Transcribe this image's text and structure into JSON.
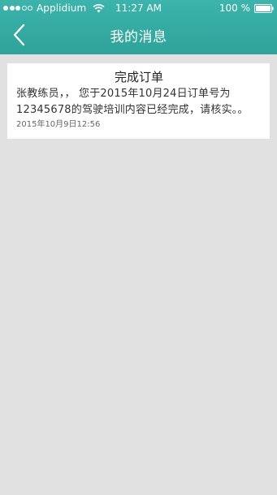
{
  "status_bar": {
    "carrier": "Applidium",
    "time": "11:27 AM",
    "battery": "100 %"
  },
  "nav": {
    "title": "我的消息",
    "back_icon": "chevron-left-icon"
  },
  "colors": {
    "header": "#35aca3",
    "background": "#e2e1e2",
    "card": "#ffffff"
  },
  "messages": [
    {
      "title": "完成订单",
      "body": "张教练员，， 您于2015年10月24日订单号为12345678的驾驶培训内容已经完成，请核实。。",
      "time": "2015年10月9日12:56"
    }
  ]
}
